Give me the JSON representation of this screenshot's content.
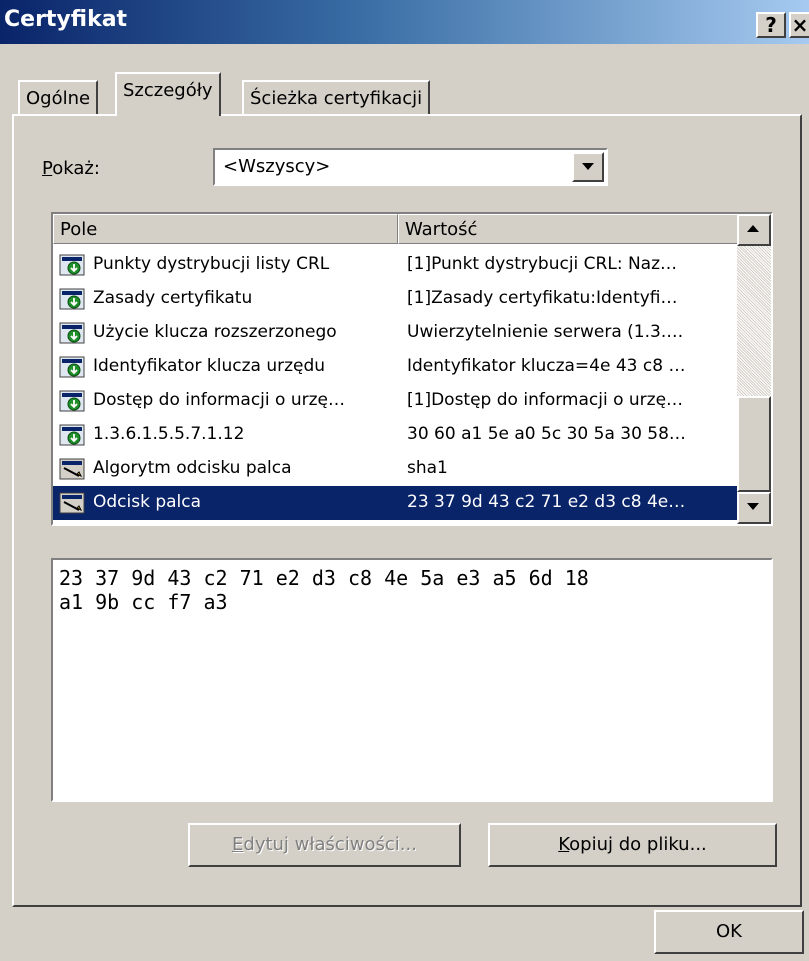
{
  "window": {
    "title": "Certyfikat",
    "help_label": "?",
    "close_label": "×"
  },
  "tabs": [
    {
      "label": "Ogólne",
      "selected": false
    },
    {
      "label": "Szczegóły",
      "selected": true
    },
    {
      "label": "Ścieżka certyfikacji",
      "selected": false
    }
  ],
  "show": {
    "label_accel": "P",
    "label_rest": "okaż:",
    "value": "<Wszyscy>"
  },
  "list": {
    "columns": [
      "Pole",
      "Wartość"
    ],
    "rows": [
      {
        "icon": "certificate-extension-icon",
        "field": "Punkty dystrybucji listy CRL",
        "value": "[1]Punkt dystrybucji CRL: Naz…"
      },
      {
        "icon": "certificate-extension-icon",
        "field": "Zasady certyfikatu",
        "value": "[1]Zasady certyfikatu:Identyfi…"
      },
      {
        "icon": "certificate-extension-icon",
        "field": "Użycie klucza rozszerzonego",
        "value": "Uwierzytelnienie serwera (1.3.…"
      },
      {
        "icon": "certificate-extension-icon",
        "field": "Identyfikator klucza urzędu",
        "value": "Identyfikator klucza=4e 43 c8 …"
      },
      {
        "icon": "certificate-extension-icon",
        "field": "Dostęp do informacji o urzę…",
        "value": "[1]Dostęp do informacji o urzę…"
      },
      {
        "icon": "certificate-extension-icon",
        "field": "1.3.6.1.5.5.7.1.12",
        "value": "30 60 a1 5e a0 5c 30 5a 30 58…"
      },
      {
        "icon": "property-icon",
        "field": "Algorytm odcisku palca",
        "value": "sha1"
      },
      {
        "icon": "property-icon",
        "field": "Odcisk palca",
        "value": "23 37 9d 43 c2 71 e2 d3 c8 4e…"
      }
    ],
    "selected_index": 7
  },
  "detail": {
    "line1": "23 37 9d 43 c2 71 e2 d3 c8 4e 5a e3 a5 6d 18",
    "line2": "a1 9b cc f7 a3"
  },
  "buttons": {
    "edit_accel": "E",
    "edit_rest": "dytuj właściwości...",
    "copy_accel": "K",
    "copy_rest": "opiuj do pliku...",
    "ok": "OK"
  }
}
